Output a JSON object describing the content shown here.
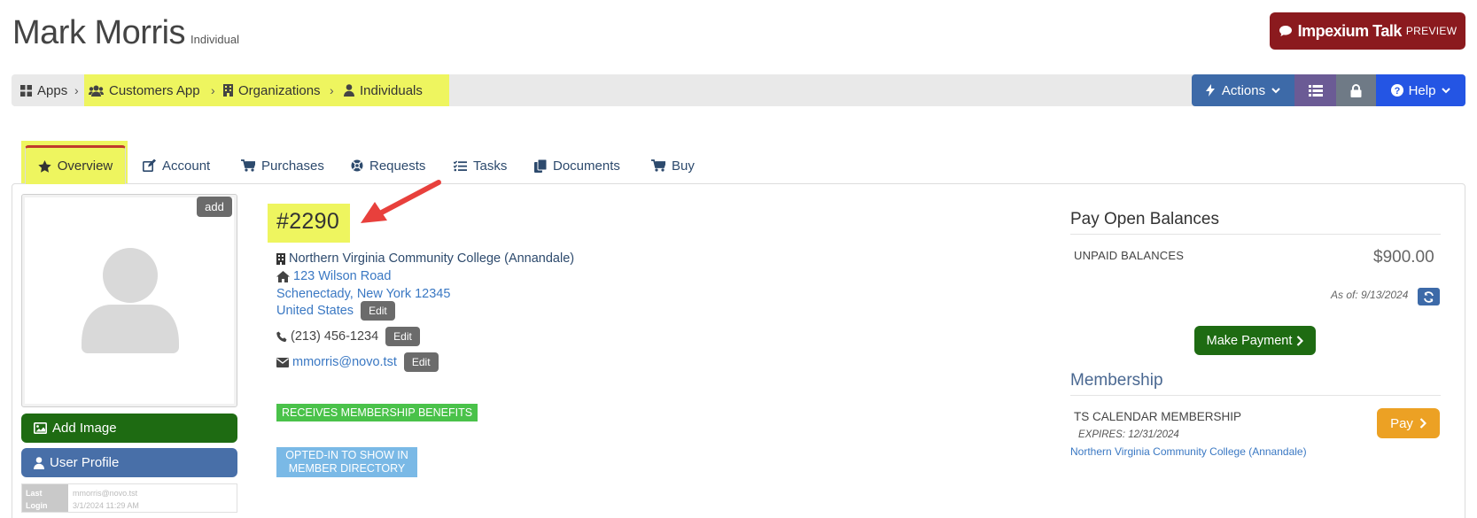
{
  "header": {
    "name": "Mark Morris",
    "type": "Individual",
    "talk_label": "Impexium Talk",
    "talk_preview": "PREVIEW"
  },
  "breadcrumb": [
    {
      "label": "Apps",
      "icon": "grid-icon"
    },
    {
      "label": "Customers App",
      "icon": "users-icon"
    },
    {
      "label": "Organizations",
      "icon": "building-icon"
    },
    {
      "label": "Individuals",
      "icon": "user-icon"
    }
  ],
  "toolbar": {
    "actions_label": "Actions",
    "help_label": "Help",
    "colors": {
      "actions": "#3d6aa8",
      "list": "#6b5b95",
      "lock": "#6f7a86",
      "help": "#2455e4"
    }
  },
  "tabs": [
    {
      "label": "Overview",
      "icon": "star-icon",
      "active": true
    },
    {
      "label": "Account",
      "icon": "edit-icon"
    },
    {
      "label": "Purchases",
      "icon": "cart-icon"
    },
    {
      "label": "Requests",
      "icon": "lifebuoy-icon"
    },
    {
      "label": "Tasks",
      "icon": "tasks-icon"
    },
    {
      "label": "Documents",
      "icon": "documents-icon"
    },
    {
      "label": "Buy",
      "icon": "cart-icon"
    }
  ],
  "profile": {
    "add_badge": "add",
    "add_image_label": "Add Image",
    "user_profile_label": "User Profile",
    "last_login_label_1": "Last",
    "last_login_label_2": "Login",
    "last_login_email": "mmorris@novo.tst",
    "last_login_time": "3/1/2024 11:29 AM"
  },
  "info": {
    "id": "#2290",
    "organization": "Northern Virginia Community College (Annandale)",
    "address_line1": "123 Wilson Road",
    "address_line2": "Schenectady, New York 12345",
    "country": "United States",
    "phone": "(213) 456-1234",
    "email": "mmorris@novo.tst",
    "edit_label": "Edit",
    "badge_benefits": "RECEIVES MEMBERSHIP BENEFITS",
    "badge_directory_1": "OPTED-IN TO SHOW IN",
    "badge_directory_2": "MEMBER DIRECTORY"
  },
  "balances": {
    "title": "Pay Open Balances",
    "unpaid_label": "UNPAID BALANCES",
    "amount": "$900.00",
    "as_of": "As of: 9/13/2024",
    "make_payment_label": "Make Payment"
  },
  "membership": {
    "title": "Membership",
    "name": "TS CALENDAR MEMBERSHIP",
    "expires": "EXPIRES: 12/31/2024",
    "organization": "Northern Virginia Community College (Annandale)",
    "pay_label": "Pay"
  }
}
